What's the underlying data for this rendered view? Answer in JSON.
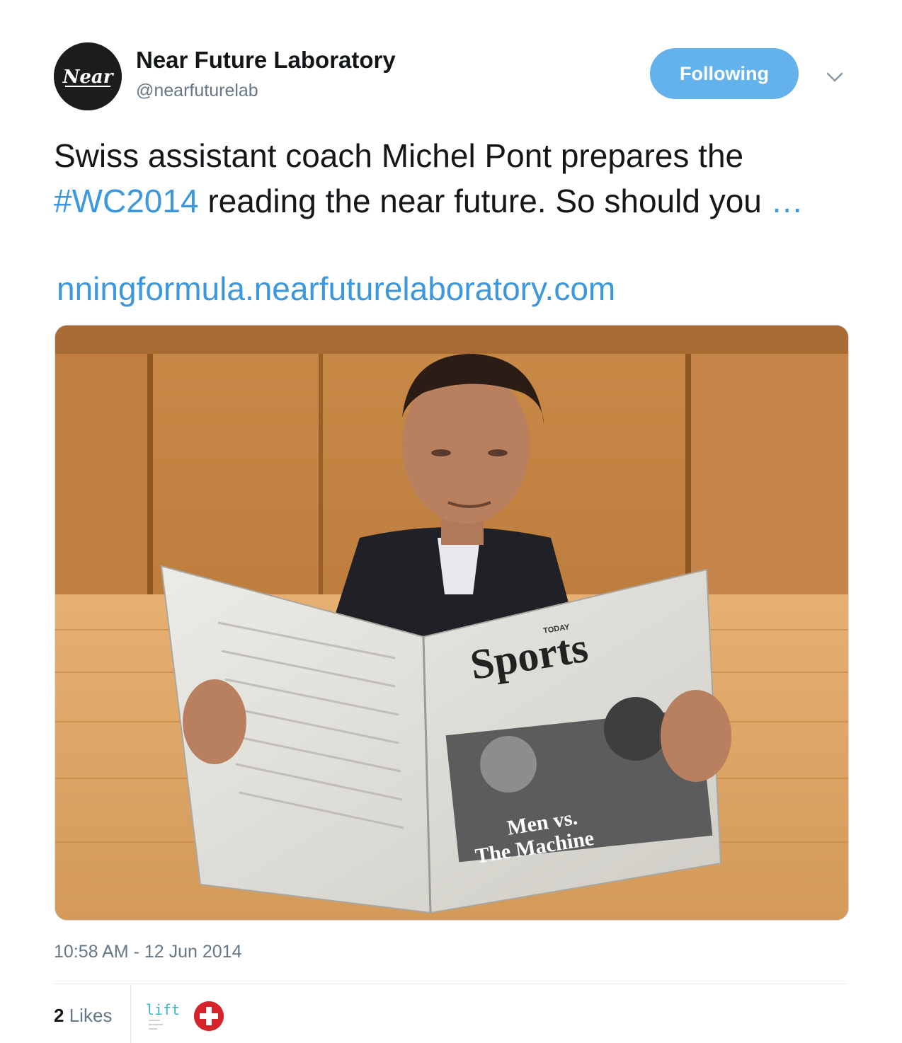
{
  "author": {
    "name": "Near Future Laboratory",
    "handle": "@nearfuturelab",
    "avatar_text": "Near",
    "avatar_icon": "near-logo-icon"
  },
  "follow_button": {
    "label": "Following",
    "color": "#64b2ec"
  },
  "menu": {
    "icon": "chevron-down-icon"
  },
  "tweet": {
    "text_before_hashtag": "Swiss assistant coach Michel Pont prepares the ",
    "hashtag": "#WC2014",
    "text_after_hashtag": " reading the near future. So should you ",
    "ellipsis": "…",
    "url": "nningformula.nearfuturelaboratory.com",
    "link_color": "#3c97dd"
  },
  "media": {
    "newspaper_masthead": "Sports",
    "newspaper_kicker": "TODAY",
    "newspaper_headline_1": "Men vs.",
    "newspaper_headline_2": "The Machine"
  },
  "meta": {
    "timestamp": "10:58 AM - 12 Jun 2014"
  },
  "engagement": {
    "likes_count": "2",
    "likes_label": "Likes",
    "likers": [
      {
        "icon": "lift-logo-icon",
        "text": "lift"
      },
      {
        "icon": "swiss-cross-icon"
      }
    ]
  }
}
